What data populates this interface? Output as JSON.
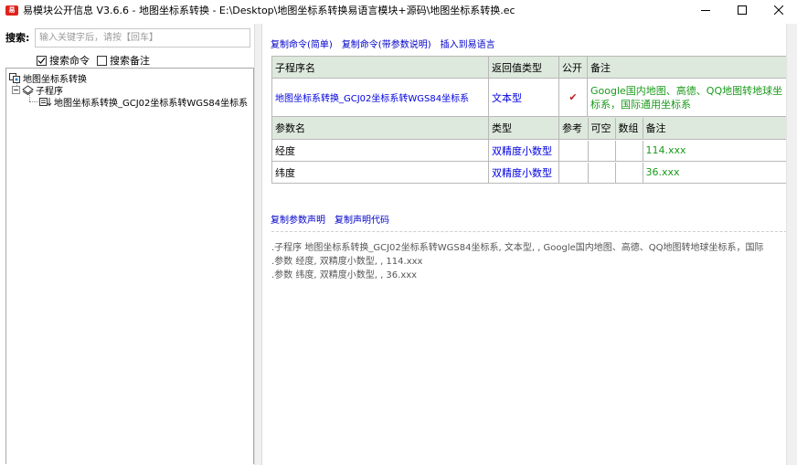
{
  "window": {
    "icon_text": "易",
    "title": "易模块公开信息 V3.6.6 - 地图坐标系转换 - E:\\Desktop\\地图坐标系转换易语言模块+源码\\地图坐标系转换.ec"
  },
  "search": {
    "label": "搜索:",
    "placeholder": "输入关键字后，请按【回车】",
    "options": [
      {
        "label": "搜索命令",
        "checked": true
      },
      {
        "label": "搜索备注",
        "checked": false
      }
    ]
  },
  "tree": {
    "root": "地图坐标系转换",
    "group": "子程序",
    "leaf": "地图坐标系转换_GCJ02坐标系转WGS84坐标系"
  },
  "toolbar_links": [
    "复制命令(简单)",
    "复制命令(带参数说明)",
    "插入到易语言"
  ],
  "sub_table": {
    "headers": [
      "子程序名",
      "返回值类型",
      "公开",
      "备注"
    ],
    "row": {
      "name": "地图坐标系转换_GCJ02坐标系转WGS84坐标系",
      "return_type": "文本型",
      "public_mark": "✔",
      "remark": "Google国内地图、高德、QQ地图转地球坐标系，国际通用坐标系"
    }
  },
  "param_table": {
    "headers": [
      "参数名",
      "类型",
      "参考",
      "可空",
      "数组",
      "备注"
    ],
    "rows": [
      {
        "name": "经度",
        "type": "双精度小数型",
        "ref": "",
        "nullable": "",
        "array": "",
        "remark": "114.xxx"
      },
      {
        "name": "纬度",
        "type": "双精度小数型",
        "ref": "",
        "nullable": "",
        "array": "",
        "remark": "36.xxx"
      }
    ]
  },
  "decl_links": [
    "复制参数声明",
    "复制声明代码"
  ],
  "declaration_lines": [
    ".子程序 地图坐标系转换_GCJ02坐标系转WGS84坐标系, 文本型, , Google国内地图、高德、QQ地图转地球坐标系，国际",
    ".参数 经度, 双精度小数型, , 114.xxx",
    ".参数 纬度, 双精度小数型, , 36.xxx"
  ],
  "colors": {
    "header_bg": "#dee9dd",
    "link_blue": "#0000cc",
    "type_blue": "#0000e0",
    "remark_green": "#1a9a1a",
    "check_red": "#c02020"
  }
}
